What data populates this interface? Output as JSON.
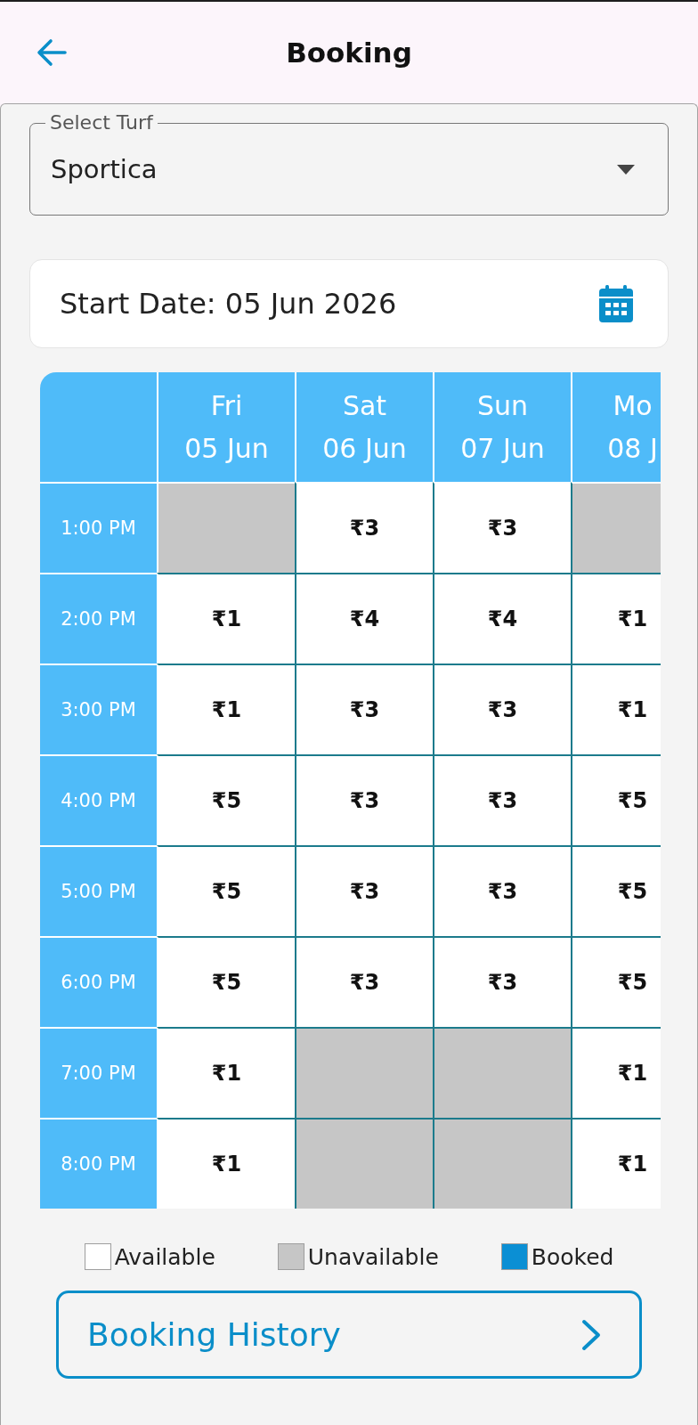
{
  "app_bar": {
    "title": "Booking"
  },
  "turf_select": {
    "label": "Select Turf",
    "value": "Sportica"
  },
  "date_card": {
    "text": "Start Date: 05 Jun 2026"
  },
  "schedule": {
    "columns": [
      {
        "day": "Fri",
        "date": "05 Jun"
      },
      {
        "day": "Sat",
        "date": "06 Jun"
      },
      {
        "day": "Sun",
        "date": "07 Jun"
      },
      {
        "day": "Mo",
        "date": "08 J"
      }
    ],
    "rows": [
      {
        "time": "1:00 PM",
        "cells": [
          {
            "kind": "unavailable"
          },
          {
            "kind": "available",
            "price": "₹3"
          },
          {
            "kind": "available",
            "price": "₹3"
          },
          {
            "kind": "unavailable"
          }
        ]
      },
      {
        "time": "2:00 PM",
        "cells": [
          {
            "kind": "available",
            "price": "₹1"
          },
          {
            "kind": "available",
            "price": "₹4"
          },
          {
            "kind": "available",
            "price": "₹4"
          },
          {
            "kind": "available",
            "price": "₹1"
          }
        ]
      },
      {
        "time": "3:00 PM",
        "cells": [
          {
            "kind": "available",
            "price": "₹1"
          },
          {
            "kind": "available",
            "price": "₹3"
          },
          {
            "kind": "available",
            "price": "₹3"
          },
          {
            "kind": "available",
            "price": "₹1"
          }
        ]
      },
      {
        "time": "4:00 PM",
        "cells": [
          {
            "kind": "available",
            "price": "₹5"
          },
          {
            "kind": "available",
            "price": "₹3"
          },
          {
            "kind": "available",
            "price": "₹3"
          },
          {
            "kind": "available",
            "price": "₹5"
          }
        ]
      },
      {
        "time": "5:00 PM",
        "cells": [
          {
            "kind": "available",
            "price": "₹5"
          },
          {
            "kind": "available",
            "price": "₹3"
          },
          {
            "kind": "available",
            "price": "₹3"
          },
          {
            "kind": "available",
            "price": "₹5"
          }
        ]
      },
      {
        "time": "6:00 PM",
        "cells": [
          {
            "kind": "available",
            "price": "₹5"
          },
          {
            "kind": "available",
            "price": "₹3"
          },
          {
            "kind": "available",
            "price": "₹3"
          },
          {
            "kind": "available",
            "price": "₹5"
          }
        ]
      },
      {
        "time": "7:00 PM",
        "cells": [
          {
            "kind": "available",
            "price": "₹1"
          },
          {
            "kind": "unavailable"
          },
          {
            "kind": "unavailable"
          },
          {
            "kind": "available",
            "price": "₹1"
          }
        ]
      },
      {
        "time": "8:00 PM",
        "cells": [
          {
            "kind": "available",
            "price": "₹1"
          },
          {
            "kind": "unavailable"
          },
          {
            "kind": "unavailable"
          },
          {
            "kind": "available",
            "price": "₹1"
          }
        ]
      }
    ]
  },
  "legend": [
    {
      "label": "Available",
      "color": "#ffffff"
    },
    {
      "label": "Unavailable",
      "color": "#c6c6c6"
    },
    {
      "label": "Booked",
      "color": "#0b8fd4"
    }
  ],
  "history_button": {
    "label": "Booking History"
  }
}
